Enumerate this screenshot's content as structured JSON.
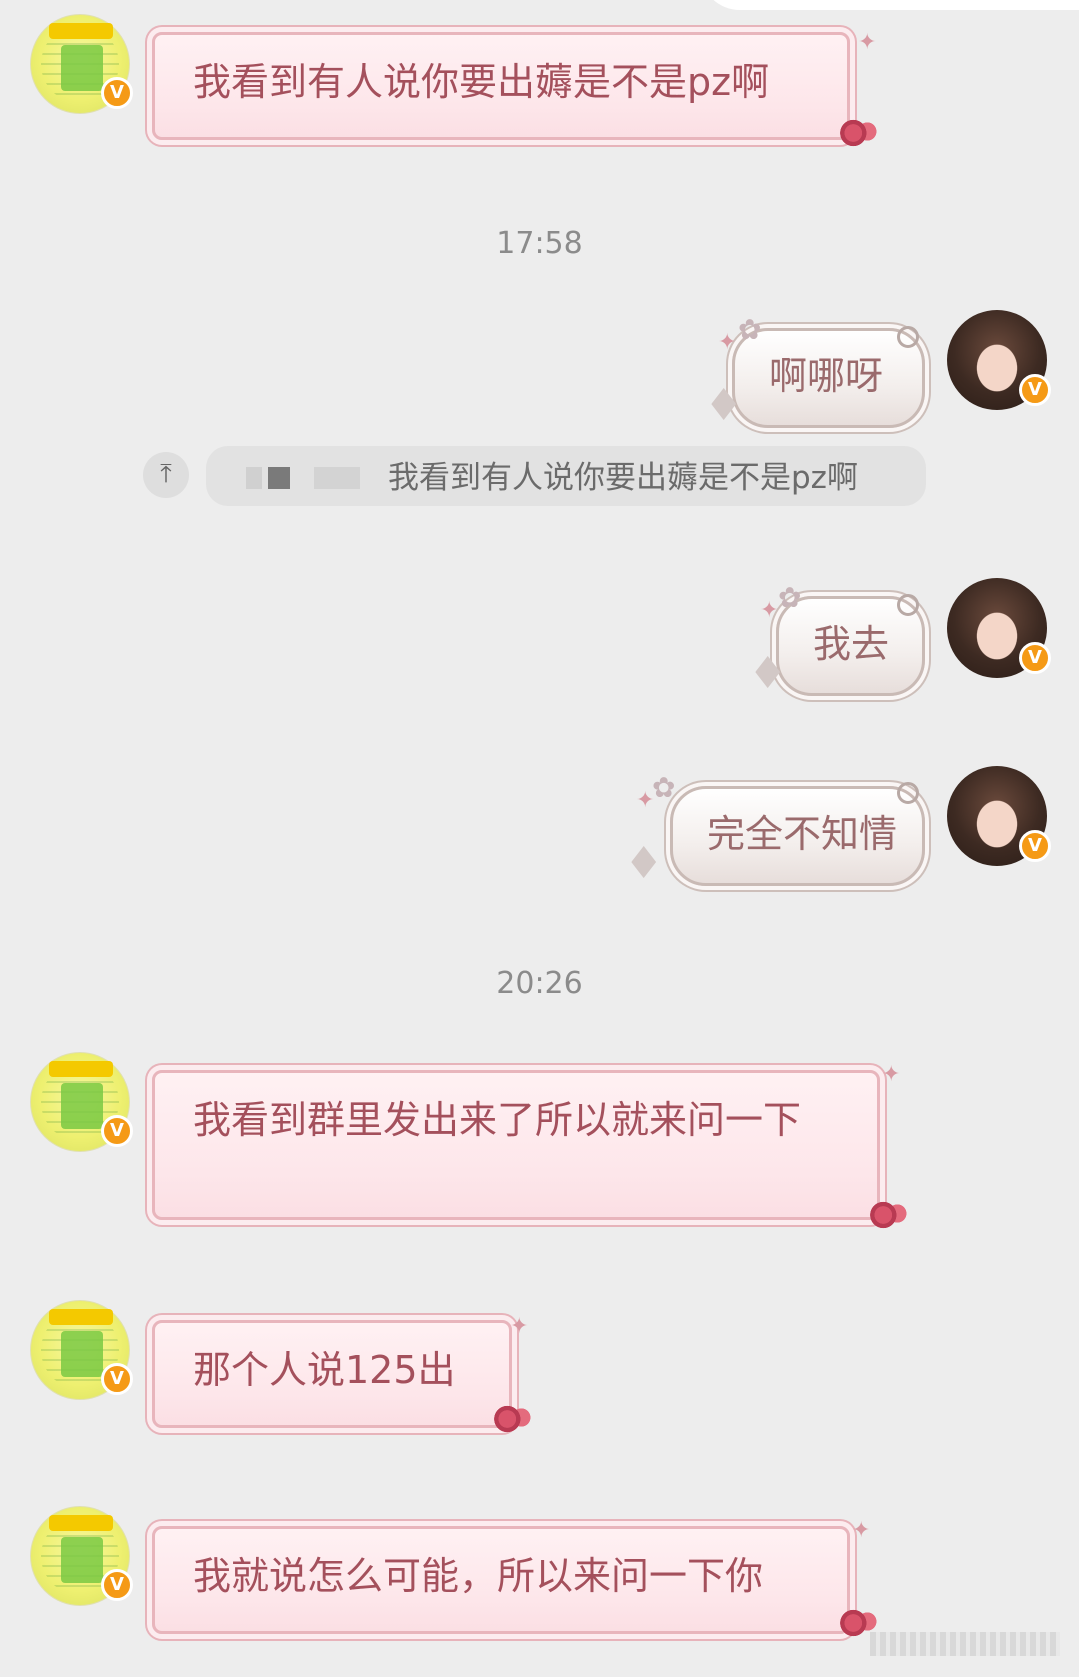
{
  "messages": [
    {
      "sender": "other",
      "text": "我看到有人说你要出薅是不是pz啊"
    },
    {
      "sender": "self",
      "text": "啊哪呀"
    },
    {
      "sender": "self",
      "text": "我去"
    },
    {
      "sender": "self",
      "text": "完全不知情"
    },
    {
      "sender": "other",
      "text": "我看到群里发出来了所以就来问一下"
    },
    {
      "sender": "other",
      "text": "那个人说125出"
    },
    {
      "sender": "other",
      "text": "我就说怎么可能，所以来问一下你"
    }
  ],
  "timestamps": [
    "17:58",
    "20:26"
  ],
  "quote": {
    "text": "我看到有人说你要出薅是不是pz啊"
  },
  "badge": {
    "label": "V",
    "color": "#f59a16"
  },
  "colors": {
    "background": "#ededed",
    "other_bubble_text": "#a4505c",
    "self_bubble_text": "#9a6a6c",
    "timestamp": "#8b8b8b"
  },
  "icons": {
    "quote_jump": "arrow-up-to-top-icon",
    "verified": "verified-badge-icon"
  }
}
